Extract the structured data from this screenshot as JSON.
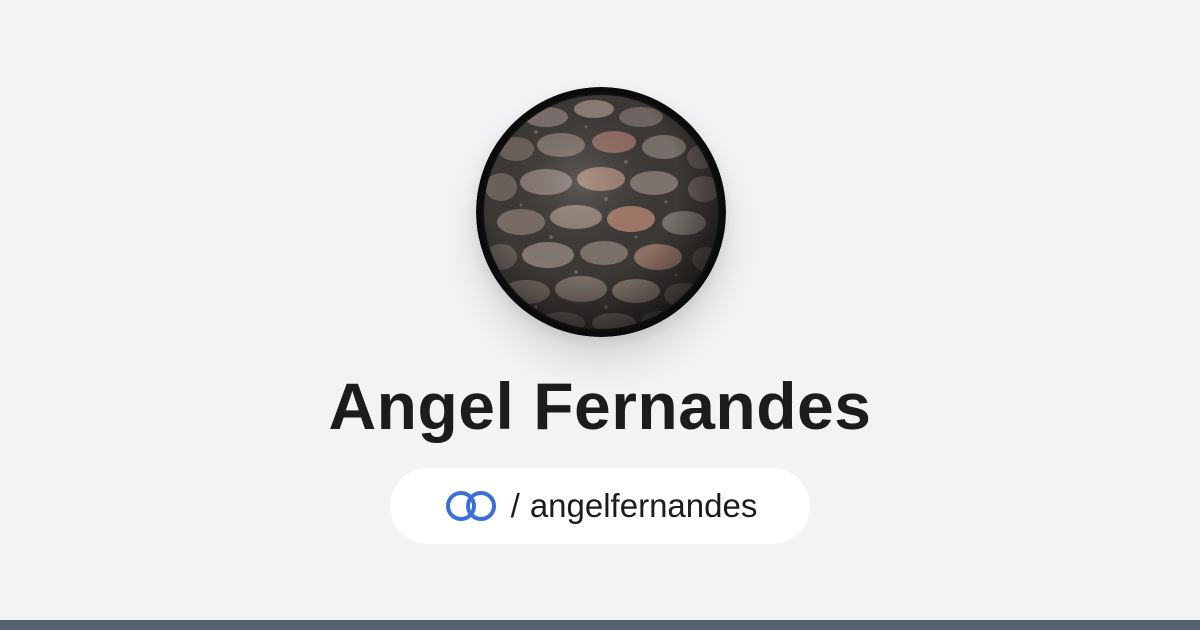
{
  "profile": {
    "name": "Angel Fernandes",
    "handle_separator": "/",
    "handle": "angelfernandes",
    "avatar_image": "stone-sphere-avatar"
  },
  "icons": {
    "link_icon": "linked-circles-icon"
  },
  "colors": {
    "background": "#f3f3f5",
    "text": "#1c1c1e",
    "pill_background": "#ffffff",
    "link_icon": "#3b6fd8",
    "bottom_bar": "#56606e"
  }
}
